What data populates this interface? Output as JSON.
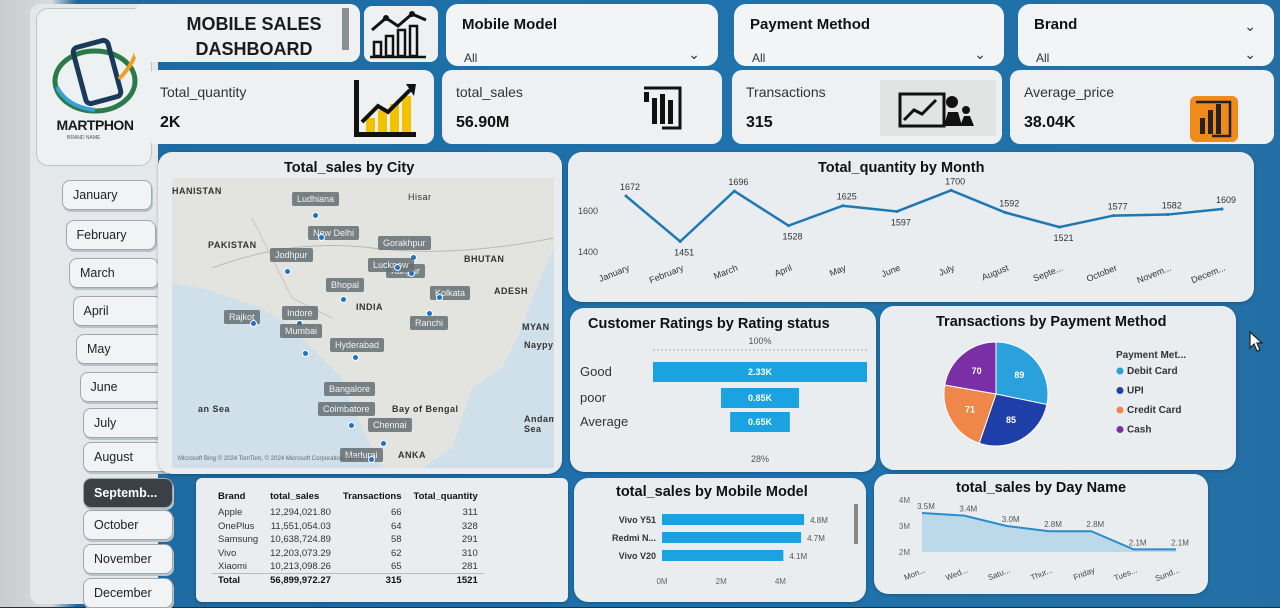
{
  "header": {
    "title_line1": "MOBILE SALES",
    "title_line2": "DASHBOARD",
    "logo_text": "MARTPHON",
    "logo_sub": "BRAND NAME"
  },
  "filters": [
    {
      "label": "Mobile Model",
      "value": "All"
    },
    {
      "label": "Payment Method",
      "value": "All"
    },
    {
      "label": "Brand",
      "value": "All"
    }
  ],
  "kpis": [
    {
      "label": "Total_quantity",
      "value": "2K"
    },
    {
      "label": "total_sales",
      "value": "56.90M"
    },
    {
      "label": "Transactions",
      "value": "315"
    },
    {
      "label": "Average_price",
      "value": "38.04K"
    }
  ],
  "months": [
    "January",
    "February",
    "March",
    "April",
    "May",
    "June",
    "July",
    "August",
    "Septemb...",
    "October",
    "November",
    "December"
  ],
  "selected_month": "Septemb...",
  "map": {
    "title": "Total_sales by City",
    "regions": [
      "HANISTAN",
      "PAKISTAN",
      "INDIA",
      "BHUTAN",
      "ADESH",
      "MYAN",
      "Naypyi",
      "an Sea",
      "Bay of Bengal",
      "Andam Sea",
      "ANKA"
    ],
    "cities": [
      "Ludhiana",
      "New Delhi",
      "Gorakhpur",
      "Jodhpur",
      "Kanpur",
      "Lucknow",
      "Bhopal",
      "Kolkata",
      "Rajkot",
      "Indore",
      "Mumbai",
      "Ranchi",
      "Hyderabad",
      "Bangalore",
      "Coimbatore",
      "Chennai",
      "Madurai"
    ],
    "nearby": [
      "Hisar"
    ],
    "credit": "Microsoft Bing  © 2024 TomTom, © 2024 Microsoft Corporation, Terms"
  },
  "chart_data": [
    {
      "type": "line",
      "title": "Total_quantity by Month",
      "categories": [
        "January",
        "February",
        "March",
        "April",
        "May",
        "June",
        "July",
        "August",
        "Septe...",
        "October",
        "Novem...",
        "Decem..."
      ],
      "values": [
        1672,
        1451,
        1696,
        1528,
        1625,
        1597,
        1700,
        1592,
        1521,
        1577,
        1582,
        1609
      ],
      "y_ticks": [
        1400,
        1600
      ],
      "ylim": [
        1400,
        1750
      ],
      "color": "#1f77b4"
    },
    {
      "type": "bar",
      "title": "Customer Ratings by Rating status",
      "categories": [
        "Good",
        "poor",
        "Average"
      ],
      "values": [
        2.33,
        0.85,
        0.65
      ],
      "labels": [
        "2.33K",
        "0.85K",
        "0.65K"
      ],
      "top_label": "100%",
      "bottom_label": "28%",
      "color": "#1aa3e0"
    },
    {
      "type": "pie",
      "title": "Transactions by Payment Method",
      "legend_title": "Payment Met...",
      "categories": [
        "Debit Card",
        "UPI",
        "Credit Card",
        "Cash"
      ],
      "values": [
        89,
        85,
        71,
        70
      ],
      "colors": [
        "#2aa0dc",
        "#1f3fa8",
        "#f0874a",
        "#7b2fa6"
      ]
    },
    {
      "type": "bar",
      "title": "total_sales by Mobile Model",
      "categories": [
        "Vivo Y51",
        "Redmi N...",
        "Vivo V20"
      ],
      "values": [
        4.8,
        4.7,
        4.1
      ],
      "labels": [
        "4.8M",
        "4.7M",
        "4.1M"
      ],
      "x_ticks": [
        "0M",
        "2M",
        "4M"
      ],
      "color": "#1aa3e0"
    },
    {
      "type": "area",
      "title": "total_sales by Day Name",
      "categories": [
        "Mon...",
        "Wed...",
        "Satu...",
        "Thur...",
        "Friday",
        "Tues...",
        "Sund..."
      ],
      "values": [
        3.5,
        3.4,
        3.0,
        2.8,
        2.8,
        2.1,
        2.1
      ],
      "labels": [
        "3.5M",
        "3.4M",
        "3.0M",
        "2.8M",
        "2.8M",
        "2.1M",
        "2.1M"
      ],
      "y_ticks": [
        "2M",
        "3M",
        "4M"
      ],
      "ylim": [
        2,
        4
      ],
      "color": "#2a8cc8"
    }
  ],
  "brand_table": {
    "headers": [
      "Brand",
      "total_sales",
      "Transactions",
      "Total_quantity"
    ],
    "rows": [
      [
        "Apple",
        "12,294,021.80",
        "66",
        "311"
      ],
      [
        "OnePlus",
        "11,551,054.03",
        "64",
        "328"
      ],
      [
        "Samsung",
        "10,638,724.89",
        "58",
        "291"
      ],
      [
        "Vivo",
        "12,203,073.29",
        "62",
        "310"
      ],
      [
        "Xiaomi",
        "10,213,098.26",
        "65",
        "281"
      ]
    ],
    "total": [
      "Total",
      "56,899,972.27",
      "315",
      "1521"
    ]
  }
}
